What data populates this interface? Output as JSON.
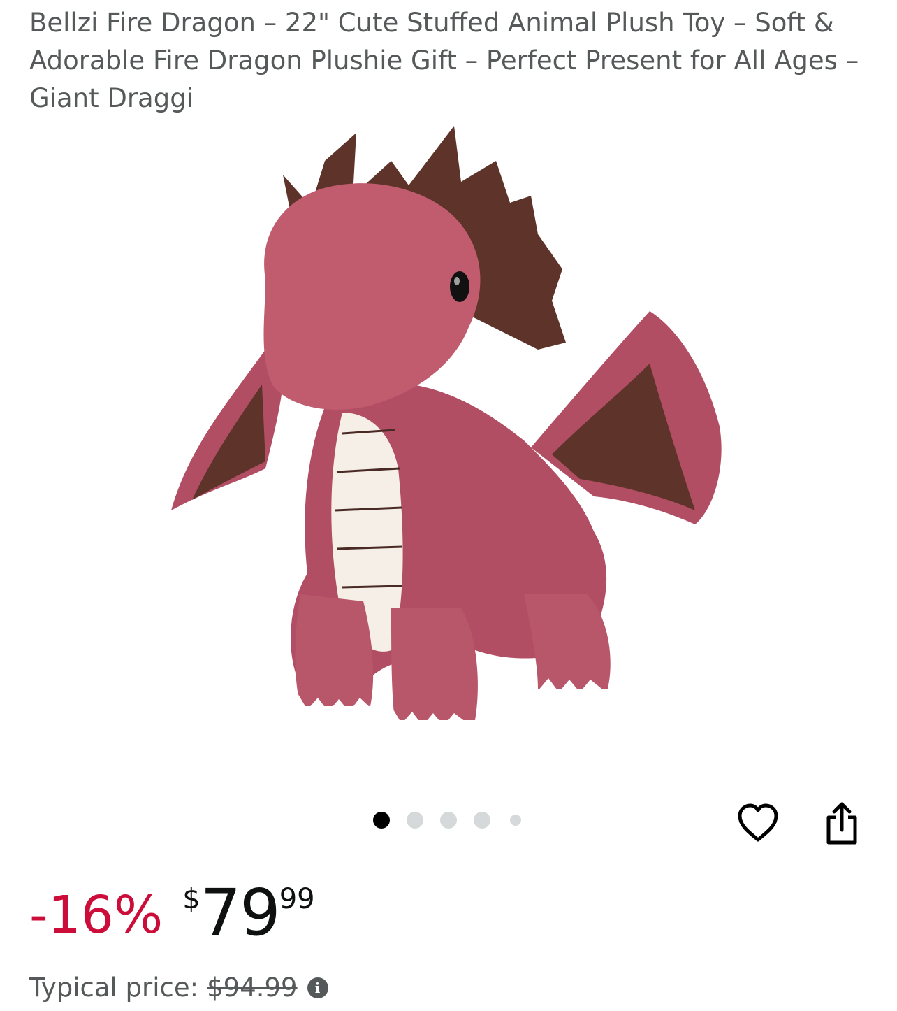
{
  "product": {
    "title": "Bellzi Fire Dragon – 22\" Cute Stuffed Animal Plush Toy – Soft & Adorable Fire Dragon Plushie Gift – Perfect Present for All Ages – Giant Draggi",
    "image_icon": "pink-dragon-plush-image"
  },
  "carousel": {
    "total_images": 5,
    "active_index": 0
  },
  "actions": {
    "favorite_icon": "heart-outline-icon",
    "share_icon": "share-icon"
  },
  "pricing": {
    "discount": "-16%",
    "currency_symbol": "$",
    "price_whole": "79",
    "price_fraction": "99",
    "typical_label": "Typical price:",
    "typical_price": "$94.99",
    "info_icon": "info-icon",
    "discount_color": "#cc0c39"
  }
}
